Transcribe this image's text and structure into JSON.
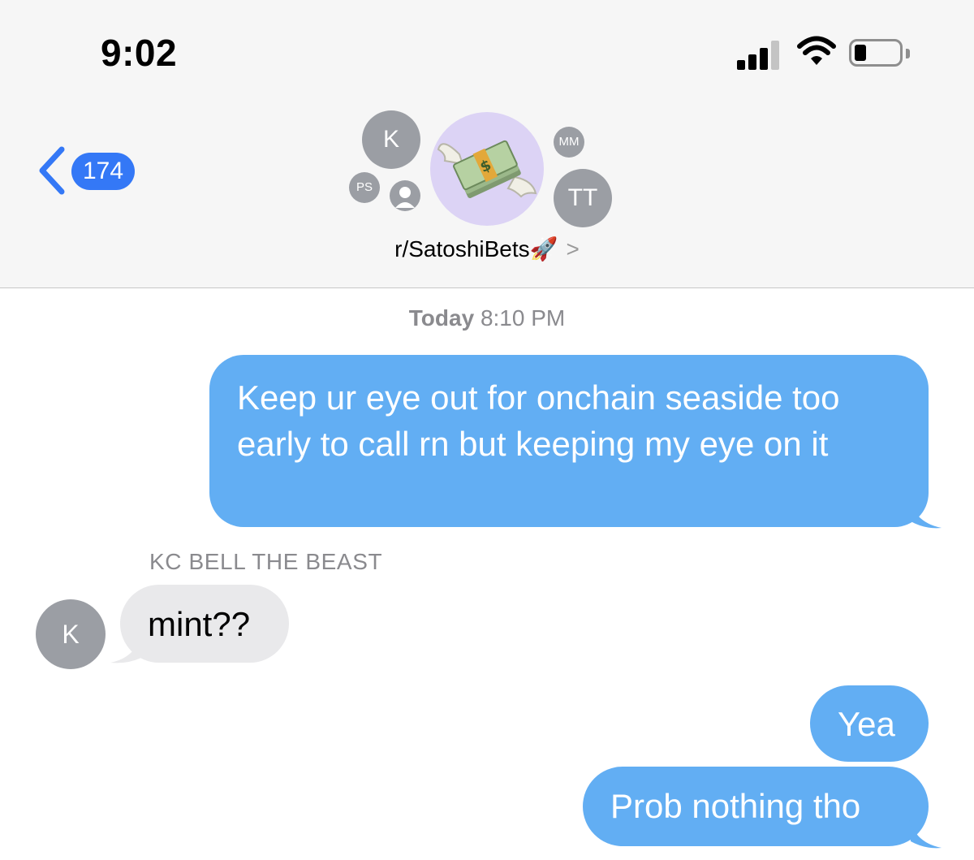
{
  "status_bar": {
    "time": "9:02",
    "signal_icon": "cellular-signal-icon",
    "wifi_icon": "wifi-icon",
    "battery_icon": "battery-icon",
    "battery_level": 0.2
  },
  "header": {
    "back_count": "174",
    "group_title": "r/SatoshiBets🚀",
    "group_icon": "money-with-wings-icon",
    "participants": [
      {
        "initials": "K"
      },
      {
        "initials": "PS"
      },
      {
        "initials": ""
      },
      {
        "initials": "MM"
      },
      {
        "initials": "TT"
      }
    ]
  },
  "conversation": {
    "timestamp_day": "Today",
    "timestamp_time": "8:10 PM",
    "messages": [
      {
        "direction": "outgoing",
        "text": "Keep ur eye out for onchain seaside too early to call rn but keeping my eye on it"
      },
      {
        "direction": "incoming",
        "sender": "KC BELL THE BEAST",
        "sender_initials": "K",
        "text": "mint??"
      },
      {
        "direction": "outgoing",
        "text": "Yea"
      },
      {
        "direction": "outgoing",
        "text": "Prob nothing tho"
      }
    ]
  },
  "colors": {
    "outgoing_bubble": "#62aef3",
    "incoming_bubble": "#e9e9eb",
    "ios_blue": "#3478f6",
    "avatar_gray": "#9b9ea4"
  }
}
